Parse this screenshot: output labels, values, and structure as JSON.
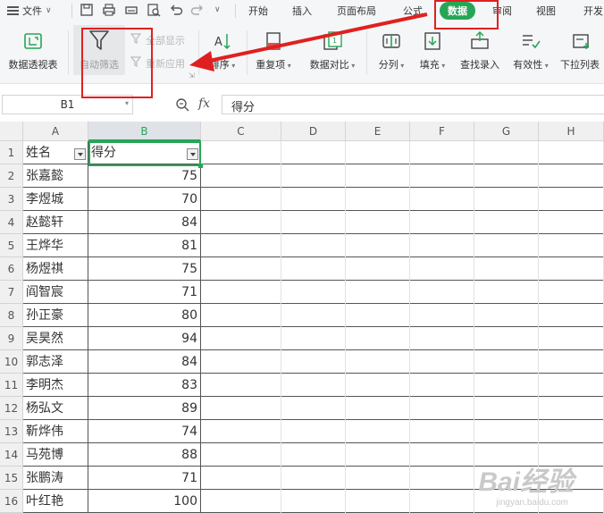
{
  "menu": {
    "file_label": "文件",
    "tabs": [
      "开始",
      "插入",
      "页面布局",
      "公式",
      "数据",
      "审阅",
      "视图",
      "开发"
    ],
    "active_tab": "数据"
  },
  "ribbon": {
    "pivot_label": "数据透视表",
    "autofilter_label": "自动筛选",
    "show_all_label": "全部显示",
    "reapply_label": "重新应用",
    "sort_label": "排序",
    "duplicates_label": "重复项",
    "compare_label": "数据对比",
    "split_label": "分列",
    "fill_label": "填充",
    "lookup_label": "查找录入",
    "validity_label": "有效性",
    "dropdown_label": "下拉列表"
  },
  "formula_bar": {
    "cell_ref": "B1",
    "fx_label": "fx",
    "content": "得分"
  },
  "columns": [
    "A",
    "B",
    "C",
    "D",
    "E",
    "F",
    "G",
    "H"
  ],
  "selected_column": "B",
  "header_row": {
    "row": "1",
    "name": "姓名",
    "score": "得分"
  },
  "rows": [
    {
      "row": "2",
      "name": "张嘉懿",
      "score": "75"
    },
    {
      "row": "3",
      "name": "李煜城",
      "score": "70"
    },
    {
      "row": "4",
      "name": "赵懿轩",
      "score": "84"
    },
    {
      "row": "5",
      "name": "王烨华",
      "score": "81"
    },
    {
      "row": "6",
      "name": "杨煜祺",
      "score": "75"
    },
    {
      "row": "7",
      "name": "阎智宸",
      "score": "71"
    },
    {
      "row": "8",
      "name": "孙正豪",
      "score": "80"
    },
    {
      "row": "9",
      "name": "吴昊然",
      "score": "94"
    },
    {
      "row": "10",
      "name": "郭志泽",
      "score": "84"
    },
    {
      "row": "11",
      "name": "李明杰",
      "score": "83"
    },
    {
      "row": "12",
      "name": "杨弘文",
      "score": "89"
    },
    {
      "row": "13",
      "name": "靳烨伟",
      "score": "74"
    },
    {
      "row": "14",
      "name": "马苑博",
      "score": "88"
    },
    {
      "row": "15",
      "name": "张鹏涛",
      "score": "71"
    },
    {
      "row": "16",
      "name": "叶红艳",
      "score": "100"
    }
  ],
  "watermark": {
    "text": "Bai经验",
    "url": "jingyan.baidu.com"
  },
  "colors": {
    "accent_green": "#27a556",
    "annotation_red": "#e02020"
  }
}
